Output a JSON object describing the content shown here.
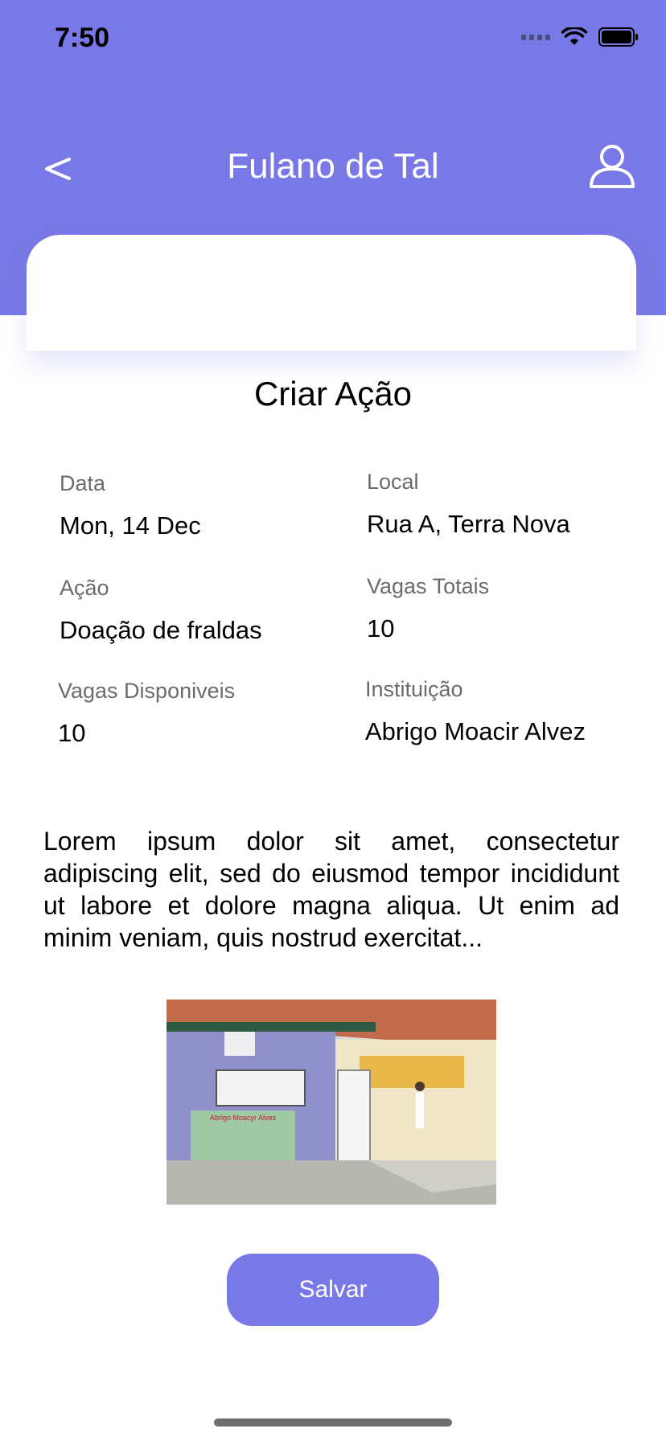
{
  "status_bar": {
    "time": "7:50"
  },
  "header": {
    "title": "Fulano de Tal",
    "back_symbol": "<",
    "background_color": "#7878E6"
  },
  "page": {
    "title": "Criar Ação"
  },
  "fields": [
    {
      "label": "Data",
      "value": "Mon, 14 Dec"
    },
    {
      "label": "Local",
      "value": "Rua A, Terra Nova"
    },
    {
      "label": "Ação",
      "value": "Doação de fraldas"
    },
    {
      "label": "Vagas Totais",
      "value": "10"
    },
    {
      "label": "Vagas Disponiveis",
      "value": "10"
    },
    {
      "label": "Instituição",
      "value": "Abrigo Moacir Alvez"
    }
  ],
  "description": "Lorem ipsum dolor sit amet, consectetur adipiscing elit, sed do eiusmod tempor incididunt ut labore et dolore magna aliqua. Ut enim ad minim veniam, quis nostrud exercitat...",
  "photo": {
    "sign_text": "Abrigo Moacyr Alves"
  },
  "actions": {
    "save_label": "Salvar"
  },
  "icons": {
    "back": "chevron-left-icon",
    "profile": "user-icon",
    "signal": "signal-icon",
    "wifi": "wifi-icon",
    "battery": "battery-icon"
  }
}
